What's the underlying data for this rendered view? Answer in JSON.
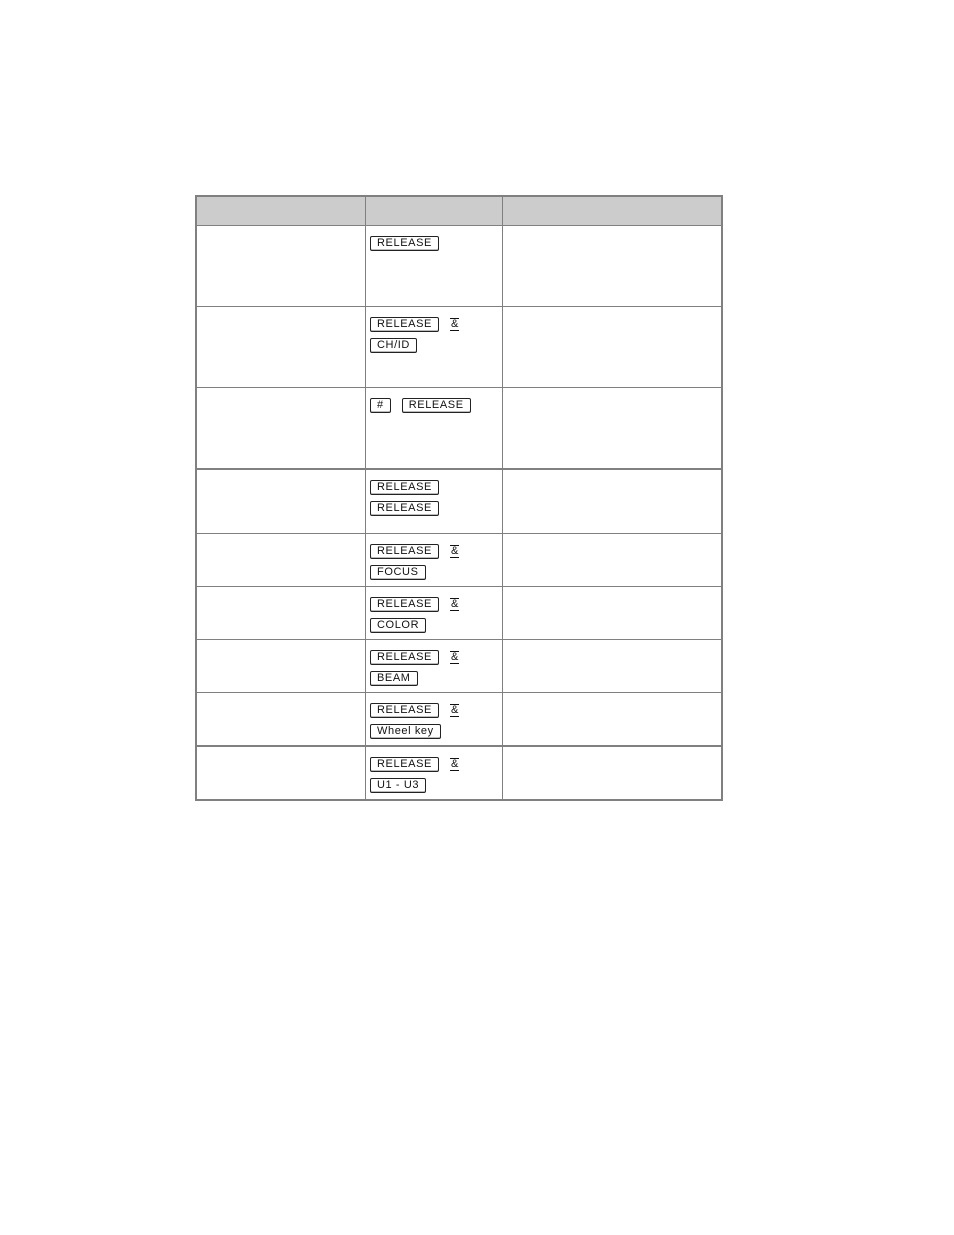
{
  "table": {
    "headers": [
      "",
      "",
      ""
    ],
    "rows": [
      {
        "keys_line1": [
          "RELEASE"
        ],
        "keys_line2": [],
        "amp": false
      },
      {
        "keys_line1": [
          "RELEASE"
        ],
        "keys_line2": [
          "CH/ID"
        ],
        "amp": true
      },
      {
        "keys_line1": [
          "#",
          "RELEASE"
        ],
        "keys_line2": [],
        "amp": false
      },
      {
        "keys_line1": [
          "RELEASE"
        ],
        "keys_line2": [
          "RELEASE"
        ],
        "amp": false
      },
      {
        "keys_line1": [
          "RELEASE"
        ],
        "keys_line2": [
          "FOCUS"
        ],
        "amp": true
      },
      {
        "keys_line1": [
          "RELEASE"
        ],
        "keys_line2": [
          "COLOR"
        ],
        "amp": true
      },
      {
        "keys_line1": [
          "RELEASE"
        ],
        "keys_line2": [
          "BEAM"
        ],
        "amp": true
      },
      {
        "keys_line1": [
          "RELEASE"
        ],
        "keys_line2": [
          "Wheel key"
        ],
        "amp": true
      },
      {
        "keys_line1": [
          "RELEASE"
        ],
        "keys_line2": [
          "U1 - U3"
        ],
        "amp": true
      }
    ],
    "amp_symbol": "&"
  },
  "colors": {
    "header_bg": "#cccccc",
    "border": "#808080"
  }
}
